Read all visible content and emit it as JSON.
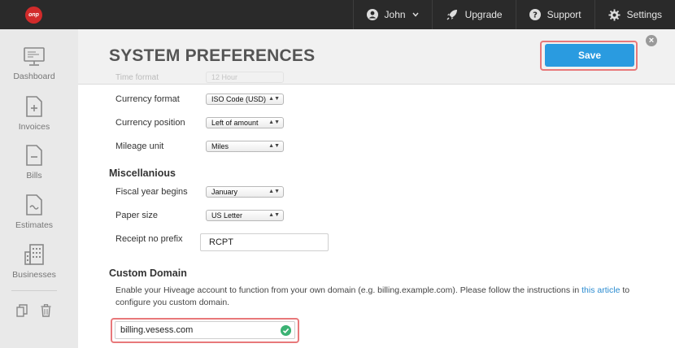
{
  "brand": {
    "logo_text": "onp",
    "accent": "#d12b2b"
  },
  "topnav": {
    "user_label": "John",
    "upgrade_label": "Upgrade",
    "support_label": "Support",
    "settings_label": "Settings"
  },
  "sidebar": {
    "items": [
      {
        "label": "Dashboard",
        "icon": "monitor-icon"
      },
      {
        "label": "Invoices",
        "icon": "invoice-icon"
      },
      {
        "label": "Bills",
        "icon": "bill-icon"
      },
      {
        "label": "Estimates",
        "icon": "estimate-icon"
      },
      {
        "label": "Businesses",
        "icon": "building-icon"
      }
    ],
    "tools": [
      "copy-icon",
      "trash-icon"
    ]
  },
  "modal": {
    "title": "SYSTEM PREFERENCES",
    "save_label": "Save",
    "close_glyph": "×",
    "ghost_rows": [
      {
        "label": "Time format",
        "value": "12 Hour"
      }
    ],
    "rows": [
      {
        "label": "Currency format",
        "value": "ISO Code (USD)"
      },
      {
        "label": "Currency position",
        "value": "Left of amount"
      },
      {
        "label": "Mileage unit",
        "value": "Miles"
      }
    ],
    "misc": {
      "title": "Miscellanious",
      "rows": [
        {
          "label": "Fiscal year begins",
          "value": "January"
        },
        {
          "label": "Paper size",
          "value": "US Letter"
        }
      ],
      "receipt_label": "Receipt no prefix",
      "receipt_value": "RCPT"
    },
    "custom_domain": {
      "title": "Custom Domain",
      "desc_before": "Enable your Hiveage account to function from your own domain (e.g. billing.example.com). Please follow the instructions in ",
      "link_text": "this article",
      "desc_after": " to configure you custom domain.",
      "value": "billing.vesess.com"
    }
  }
}
